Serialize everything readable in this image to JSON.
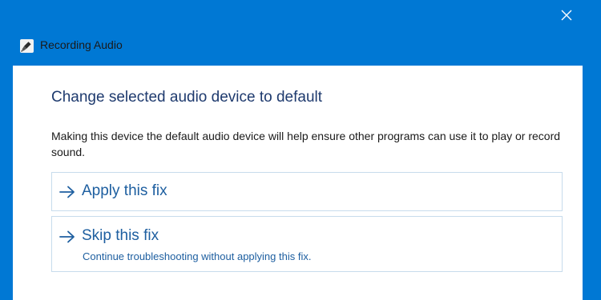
{
  "window": {
    "title": "Recording Audio",
    "close_icon": "close-icon",
    "app_icon": "microphone-icon",
    "accent_color": "#0078d4"
  },
  "main": {
    "heading": "Change selected audio device to default",
    "description": "Making this device the default audio device will help ensure other programs can use it to play or record sound.",
    "options": [
      {
        "icon": "arrow-right-icon",
        "label": "Apply this fix"
      },
      {
        "icon": "arrow-right-icon",
        "label": "Skip this fix",
        "sublabel": "Continue troubleshooting without applying this fix."
      }
    ]
  }
}
